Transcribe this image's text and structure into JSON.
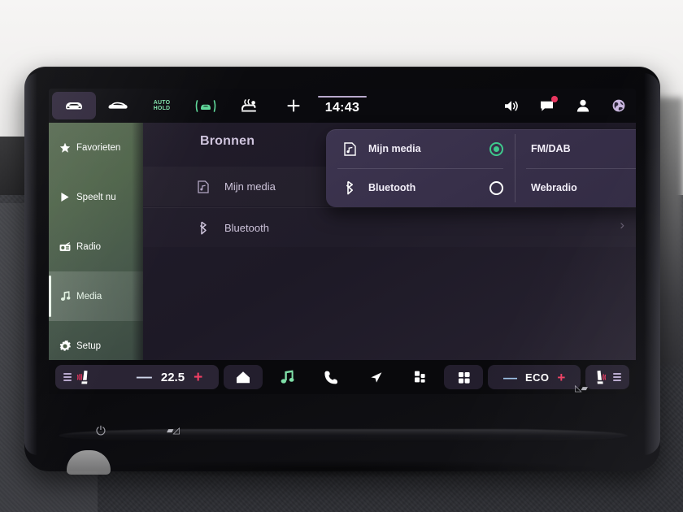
{
  "device": {
    "name": "car-infotainment-touchscreen",
    "power_icon": "power-icon",
    "bezel_slider_left": "▰◿",
    "bezel_slider_right": "◺▰"
  },
  "statusbar": {
    "clock": "14:43",
    "left_buttons": [
      {
        "name": "vehicle-front-icon",
        "icon": "car-front",
        "active": true,
        "label": ""
      },
      {
        "name": "vehicle-side-icon",
        "icon": "car-side",
        "active": false,
        "label": ""
      },
      {
        "name": "auto-hold-button",
        "icon": "text",
        "active": false,
        "label_line1": "AUTO",
        "label_line2": "HOLD"
      },
      {
        "name": "lane-assist-icon",
        "icon": "lane-assist",
        "active": false,
        "label": ""
      },
      {
        "name": "windshield-defrost-icon",
        "icon": "defrost",
        "active": false,
        "label": ""
      },
      {
        "name": "add-shortcut-button",
        "icon": "plus",
        "active": false,
        "label": "+"
      }
    ],
    "right_icons": [
      {
        "name": "volume-speaker-icon",
        "glyph": "speaker"
      },
      {
        "name": "messages-icon",
        "glyph": "message",
        "badge": true
      },
      {
        "name": "user-profile-icon",
        "glyph": "person"
      },
      {
        "name": "world-globe-icon",
        "glyph": "globe"
      }
    ]
  },
  "sidebar": {
    "items": [
      {
        "label": "Favorieten",
        "icon": "star-icon",
        "selected": false
      },
      {
        "label": "Speelt nu",
        "icon": "play-icon",
        "selected": false
      },
      {
        "label": "Radio",
        "icon": "radio-icon",
        "selected": false
      },
      {
        "label": "Media",
        "icon": "music-note-icon",
        "selected": true
      },
      {
        "label": "Setup",
        "icon": "gear-icon",
        "selected": false
      }
    ]
  },
  "main": {
    "title": "Bronnen",
    "rows": [
      {
        "label": "Mijn media",
        "icon": "media-note-frame-icon"
      },
      {
        "label": "Bluetooth",
        "icon": "bluetooth-icon"
      }
    ],
    "chevron": "›"
  },
  "dropdown": {
    "options": [
      {
        "label": "Mijn media",
        "icon": "media-note-frame-icon",
        "selected": true
      },
      {
        "label": "FM/DAB",
        "icon": "none",
        "selected": false
      },
      {
        "label": "Bluetooth",
        "icon": "bluetooth-icon",
        "selected": false
      },
      {
        "label": "Webradio",
        "icon": "none",
        "selected": false
      }
    ],
    "selected_color": "#3ec98c"
  },
  "bottombar": {
    "seat_left_icon": "seat-heating-left-icon",
    "temp_minus": "—",
    "temp_value": "22.5",
    "temp_plus": "+",
    "buttons": [
      {
        "name": "home-button",
        "icon": "home-icon",
        "boxed": true
      },
      {
        "name": "media-button",
        "icon": "music-note-icon",
        "boxed": false,
        "color": "#7fe0a8"
      },
      {
        "name": "phone-button",
        "icon": "phone-icon",
        "boxed": false,
        "color": "#ffffff"
      },
      {
        "name": "navigation-button",
        "icon": "navigation-arrow-icon",
        "boxed": false,
        "color": "#ffffff"
      },
      {
        "name": "apps-button",
        "icon": "tiles-icon",
        "boxed": false,
        "color": "#ffffff"
      },
      {
        "name": "all-apps-button",
        "icon": "grid-icon",
        "boxed": true,
        "color": "#ffffff"
      }
    ],
    "eco_minus": "—",
    "eco_label": "ECO",
    "eco_plus": "+",
    "seat_right_icon": "seat-heating-right-icon"
  },
  "colors": {
    "accent_green": "#3ec98c",
    "accent_red": "#ef3f63",
    "accent_blue": "#9fc4e8",
    "panel_purple": "#3d3550",
    "sidebar_green": "#4e6349",
    "title_lilac": "#cfc4dd"
  }
}
